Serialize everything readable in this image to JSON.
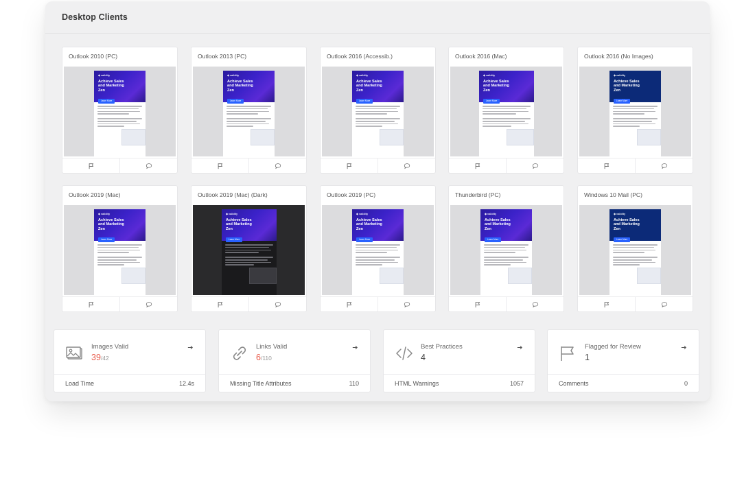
{
  "panel": {
    "title": "Desktop Clients"
  },
  "clients": [
    {
      "name": "Outlook 2010 (PC)"
    },
    {
      "name": "Outlook 2013 (PC)"
    },
    {
      "name": "Outlook 2016 (Accessib.)"
    },
    {
      "name": "Outlook 2016 (Mac)"
    },
    {
      "name": "Outlook 2016 (No Images)"
    },
    {
      "name": "Outlook 2019 (Mac)"
    },
    {
      "name": "Outlook 2019 (Mac) (Dark)"
    },
    {
      "name": "Outlook 2019 (PC)"
    },
    {
      "name": "Thunderbird (PC)"
    },
    {
      "name": "Windows 10 Mail (PC)"
    }
  ],
  "email_preview": {
    "logo": "validity",
    "headline": "Achieve Sales and Marketing Zen",
    "cta": "Learn More"
  },
  "stats": [
    {
      "label": "Images Valid",
      "value": "39",
      "denominator": "/42",
      "sub_label": "Load Time",
      "sub_value": "12.4s",
      "icon": "image-icon"
    },
    {
      "label": "Links Valid",
      "value": "6",
      "denominator": "/110",
      "sub_label": "Missing Title Attributes",
      "sub_value": "110",
      "icon": "link-icon"
    },
    {
      "label": "Best Practices",
      "value": "4",
      "denominator": "",
      "sub_label": "HTML Warnings",
      "sub_value": "1057",
      "icon": "code-icon"
    },
    {
      "label": "Flagged for Review",
      "value": "1",
      "denominator": "",
      "sub_label": "Comments",
      "sub_value": "0",
      "icon": "flag-icon"
    }
  ],
  "colors": {
    "accent_red": "#e85a4a",
    "hero_purple": "#3b22c9",
    "cta_blue": "#2962ff"
  }
}
